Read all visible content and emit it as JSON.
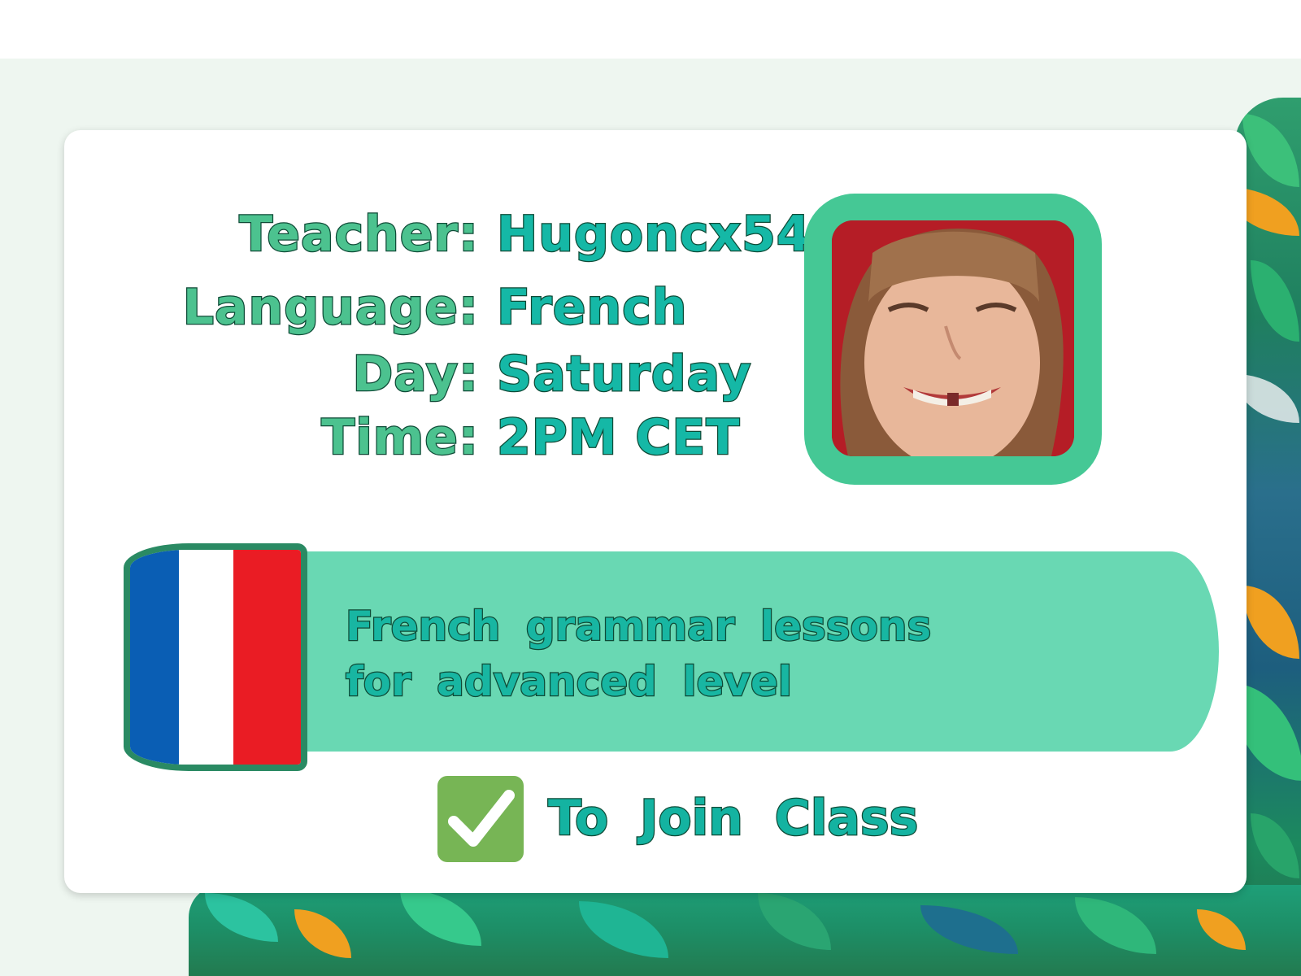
{
  "class_card": {
    "teacher": {
      "label": "Teacher:",
      "value": "Hugoncx54"
    },
    "language": {
      "label": "Language:",
      "value": "French"
    },
    "day": {
      "label": "Day:",
      "value": "Saturday"
    },
    "time": {
      "label": "Time:",
      "value": "2PM CET"
    },
    "description_line1": "French grammar lessons",
    "description_line2": "for advanced level",
    "join_label": "To Join Class",
    "flag": "france-flag",
    "photo": "teacher-photo"
  },
  "colors": {
    "label_fill": "#4cc28f",
    "value_fill": "#15b8a6",
    "text_outline": "#0e4a36",
    "banner": "#69d8b3",
    "photo_frame": "#45c895",
    "checkbox": "#77b555",
    "background": "#eef6f0"
  },
  "icons": {
    "check": "check-icon"
  }
}
